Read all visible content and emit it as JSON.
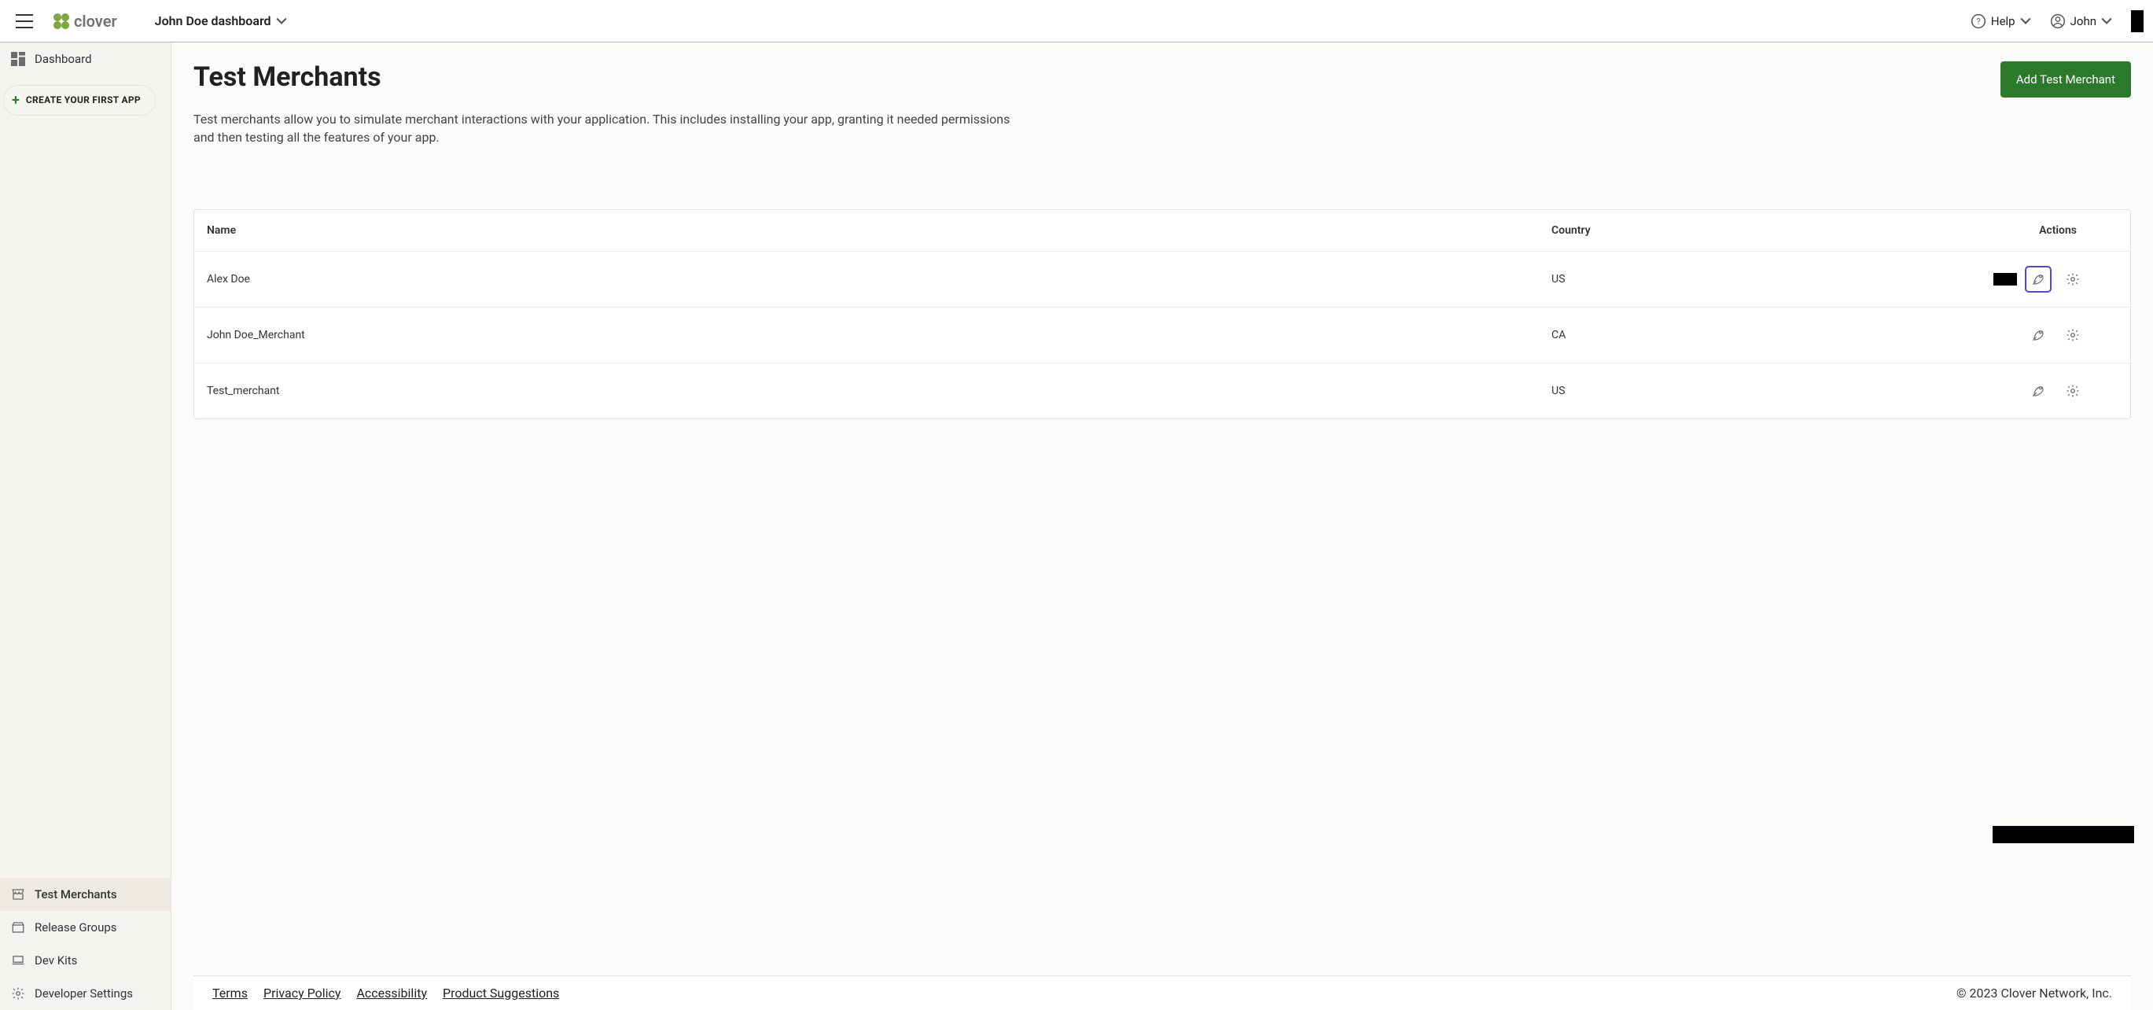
{
  "header": {
    "dashboard_title": "John Doe dashboard",
    "help_label": "Help",
    "user_label": "John"
  },
  "sidebar": {
    "create_label": "CREATE YOUR FIRST APP",
    "items": [
      {
        "label": "Dashboard"
      },
      {
        "label": "Test Merchants"
      },
      {
        "label": "Release Groups"
      },
      {
        "label": "Dev Kits"
      },
      {
        "label": "Developer Settings"
      }
    ]
  },
  "page": {
    "title": "Test Merchants",
    "cta": "Add Test Merchant",
    "description": "Test merchants allow you to simulate merchant interactions with your application. This includes installing your app, granting it needed permissions and then testing all the features of your app."
  },
  "table": {
    "columns": {
      "name": "Name",
      "country": "Country",
      "actions": "Actions"
    },
    "rows": [
      {
        "name": "Alex Doe",
        "country": "US",
        "highlight_launch": true,
        "lead_block": true
      },
      {
        "name": "John Doe_Merchant",
        "country": "CA",
        "highlight_launch": false,
        "lead_block": false
      },
      {
        "name": "Test_merchant",
        "country": "US",
        "highlight_launch": false,
        "lead_block": false
      }
    ]
  },
  "footer": {
    "links": [
      "Terms",
      "Privacy Policy",
      "Accessibility",
      "Product Suggestions"
    ],
    "copyright": "© 2023 Clover Network, Inc."
  },
  "colors": {
    "accent_green": "#2b7a2b",
    "outline_purple": "#5845d6"
  }
}
